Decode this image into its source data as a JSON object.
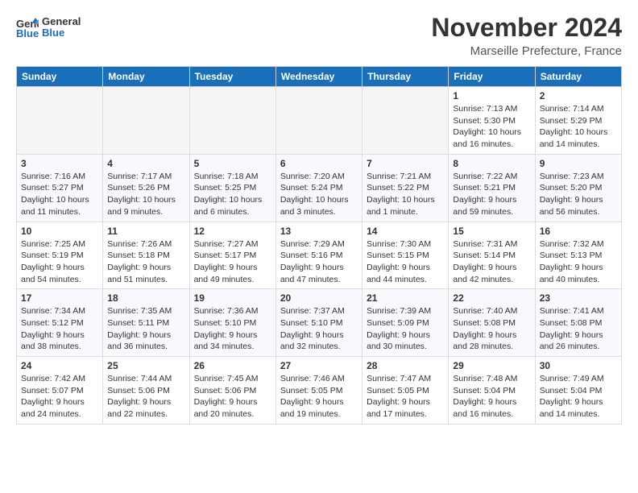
{
  "header": {
    "logo_line1": "General",
    "logo_line2": "Blue",
    "month_title": "November 2024",
    "location": "Marseille Prefecture, France"
  },
  "weekdays": [
    "Sunday",
    "Monday",
    "Tuesday",
    "Wednesday",
    "Thursday",
    "Friday",
    "Saturday"
  ],
  "weeks": [
    [
      {
        "day": "",
        "info": ""
      },
      {
        "day": "",
        "info": ""
      },
      {
        "day": "",
        "info": ""
      },
      {
        "day": "",
        "info": ""
      },
      {
        "day": "",
        "info": ""
      },
      {
        "day": "1",
        "info": "Sunrise: 7:13 AM\nSunset: 5:30 PM\nDaylight: 10 hours\nand 16 minutes."
      },
      {
        "day": "2",
        "info": "Sunrise: 7:14 AM\nSunset: 5:29 PM\nDaylight: 10 hours\nand 14 minutes."
      }
    ],
    [
      {
        "day": "3",
        "info": "Sunrise: 7:16 AM\nSunset: 5:27 PM\nDaylight: 10 hours\nand 11 minutes."
      },
      {
        "day": "4",
        "info": "Sunrise: 7:17 AM\nSunset: 5:26 PM\nDaylight: 10 hours\nand 9 minutes."
      },
      {
        "day": "5",
        "info": "Sunrise: 7:18 AM\nSunset: 5:25 PM\nDaylight: 10 hours\nand 6 minutes."
      },
      {
        "day": "6",
        "info": "Sunrise: 7:20 AM\nSunset: 5:24 PM\nDaylight: 10 hours\nand 3 minutes."
      },
      {
        "day": "7",
        "info": "Sunrise: 7:21 AM\nSunset: 5:22 PM\nDaylight: 10 hours\nand 1 minute."
      },
      {
        "day": "8",
        "info": "Sunrise: 7:22 AM\nSunset: 5:21 PM\nDaylight: 9 hours\nand 59 minutes."
      },
      {
        "day": "9",
        "info": "Sunrise: 7:23 AM\nSunset: 5:20 PM\nDaylight: 9 hours\nand 56 minutes."
      }
    ],
    [
      {
        "day": "10",
        "info": "Sunrise: 7:25 AM\nSunset: 5:19 PM\nDaylight: 9 hours\nand 54 minutes."
      },
      {
        "day": "11",
        "info": "Sunrise: 7:26 AM\nSunset: 5:18 PM\nDaylight: 9 hours\nand 51 minutes."
      },
      {
        "day": "12",
        "info": "Sunrise: 7:27 AM\nSunset: 5:17 PM\nDaylight: 9 hours\nand 49 minutes."
      },
      {
        "day": "13",
        "info": "Sunrise: 7:29 AM\nSunset: 5:16 PM\nDaylight: 9 hours\nand 47 minutes."
      },
      {
        "day": "14",
        "info": "Sunrise: 7:30 AM\nSunset: 5:15 PM\nDaylight: 9 hours\nand 44 minutes."
      },
      {
        "day": "15",
        "info": "Sunrise: 7:31 AM\nSunset: 5:14 PM\nDaylight: 9 hours\nand 42 minutes."
      },
      {
        "day": "16",
        "info": "Sunrise: 7:32 AM\nSunset: 5:13 PM\nDaylight: 9 hours\nand 40 minutes."
      }
    ],
    [
      {
        "day": "17",
        "info": "Sunrise: 7:34 AM\nSunset: 5:12 PM\nDaylight: 9 hours\nand 38 minutes."
      },
      {
        "day": "18",
        "info": "Sunrise: 7:35 AM\nSunset: 5:11 PM\nDaylight: 9 hours\nand 36 minutes."
      },
      {
        "day": "19",
        "info": "Sunrise: 7:36 AM\nSunset: 5:10 PM\nDaylight: 9 hours\nand 34 minutes."
      },
      {
        "day": "20",
        "info": "Sunrise: 7:37 AM\nSunset: 5:10 PM\nDaylight: 9 hours\nand 32 minutes."
      },
      {
        "day": "21",
        "info": "Sunrise: 7:39 AM\nSunset: 5:09 PM\nDaylight: 9 hours\nand 30 minutes."
      },
      {
        "day": "22",
        "info": "Sunrise: 7:40 AM\nSunset: 5:08 PM\nDaylight: 9 hours\nand 28 minutes."
      },
      {
        "day": "23",
        "info": "Sunrise: 7:41 AM\nSunset: 5:08 PM\nDaylight: 9 hours\nand 26 minutes."
      }
    ],
    [
      {
        "day": "24",
        "info": "Sunrise: 7:42 AM\nSunset: 5:07 PM\nDaylight: 9 hours\nand 24 minutes."
      },
      {
        "day": "25",
        "info": "Sunrise: 7:44 AM\nSunset: 5:06 PM\nDaylight: 9 hours\nand 22 minutes."
      },
      {
        "day": "26",
        "info": "Sunrise: 7:45 AM\nSunset: 5:06 PM\nDaylight: 9 hours\nand 20 minutes."
      },
      {
        "day": "27",
        "info": "Sunrise: 7:46 AM\nSunset: 5:05 PM\nDaylight: 9 hours\nand 19 minutes."
      },
      {
        "day": "28",
        "info": "Sunrise: 7:47 AM\nSunset: 5:05 PM\nDaylight: 9 hours\nand 17 minutes."
      },
      {
        "day": "29",
        "info": "Sunrise: 7:48 AM\nSunset: 5:04 PM\nDaylight: 9 hours\nand 16 minutes."
      },
      {
        "day": "30",
        "info": "Sunrise: 7:49 AM\nSunset: 5:04 PM\nDaylight: 9 hours\nand 14 minutes."
      }
    ]
  ]
}
